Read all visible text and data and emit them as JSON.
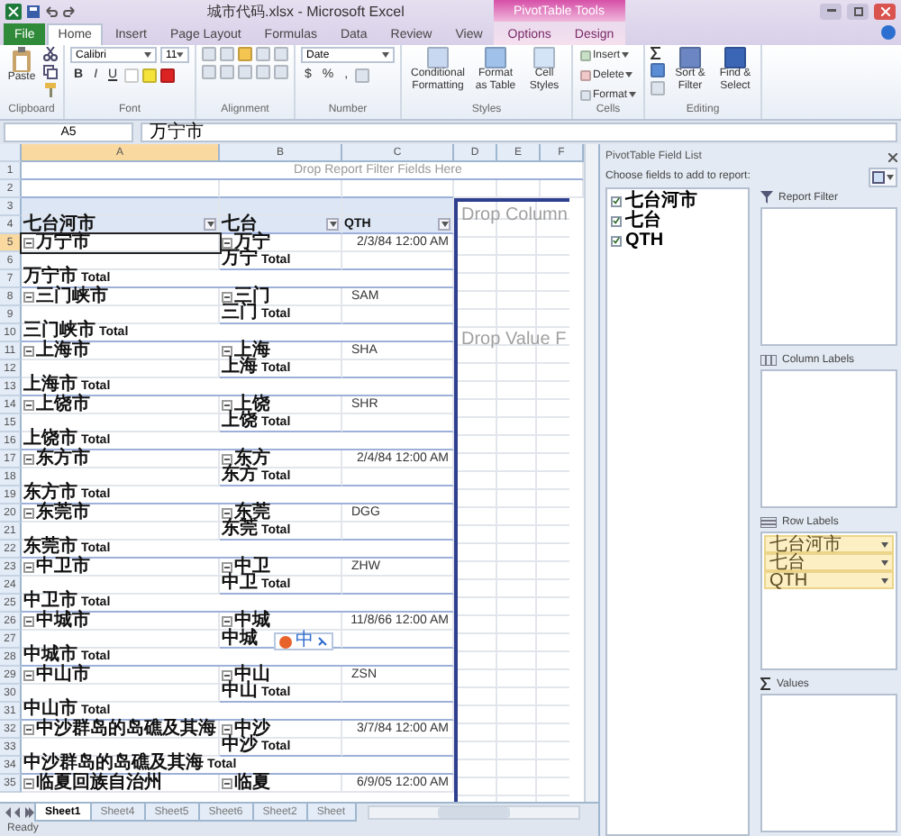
{
  "window": {
    "title": "城市代码.xlsx - Microsoft Excel",
    "context_tab": "PivotTable Tools"
  },
  "ribbon_tabs": [
    {
      "label": "File",
      "kind": "file",
      "selected": false
    },
    {
      "label": "Home",
      "kind": "tab",
      "selected": true
    },
    {
      "label": "Insert",
      "kind": "tab",
      "selected": false
    },
    {
      "label": "Page Layout",
      "kind": "tab",
      "selected": false
    },
    {
      "label": "Formulas",
      "kind": "tab",
      "selected": false
    },
    {
      "label": "Data",
      "kind": "tab",
      "selected": false
    },
    {
      "label": "Review",
      "kind": "tab",
      "selected": false
    },
    {
      "label": "View",
      "kind": "tab",
      "selected": false
    },
    {
      "label": "Options",
      "kind": "context",
      "selected": false
    },
    {
      "label": "Design",
      "kind": "context",
      "selected": false
    }
  ],
  "ribbon": {
    "paste": "Paste",
    "font_name": "Calibri",
    "font_size": "11",
    "font_styles": [
      "B",
      "I",
      "U"
    ],
    "number_format": "Date",
    "number_buttons": [
      "$",
      "%",
      ","
    ],
    "styles_buttons": [
      "Conditional Formatting",
      "Format as Table",
      "Cell Styles"
    ],
    "cells_buttons": [
      "Insert",
      "Delete",
      "Format"
    ],
    "editing_buttons": [
      "Sort & Filter",
      "Find & Select"
    ],
    "groups": [
      "Clipboard",
      "Font",
      "Alignment",
      "Number",
      "Styles",
      "Cells",
      "Editing"
    ]
  },
  "formula_bar": {
    "name_box": "A5",
    "value": "万宁市"
  },
  "columns": [
    "A",
    "B",
    "C",
    "D",
    "E",
    "F"
  ],
  "pivot": {
    "filter_hint": "Drop Report Filter Fields Here",
    "drop_column": "Drop Column",
    "drop_value": "Drop Value F",
    "headers": [
      "七台河市",
      "七台",
      "QTH"
    ]
  },
  "rows": [
    {
      "number": "1",
      "kind": "filter"
    },
    {
      "number": "2",
      "kind": "blank"
    },
    {
      "number": "3",
      "kind": "band"
    },
    {
      "number": "4",
      "kind": "header"
    },
    {
      "number": "5",
      "kind": "date_item",
      "a": "万宁市",
      "b": "万宁",
      "c": "2/3/84 12:00 AM",
      "selected": true
    },
    {
      "number": "6",
      "kind": "subtotal",
      "b": "万宁 Total"
    },
    {
      "number": "7",
      "kind": "total",
      "a": "万宁市 Total"
    },
    {
      "number": "8",
      "kind": "code_item",
      "a": "三门峡市",
      "b": "三门",
      "c": "SAM",
      "selected": false
    },
    {
      "number": "9",
      "kind": "subtotal",
      "b": "三门 Total"
    },
    {
      "number": "10",
      "kind": "total",
      "a": "三门峡市 Total"
    },
    {
      "number": "11",
      "kind": "code_item",
      "a": "上海市",
      "b": "上海",
      "c": "SHA",
      "selected": false
    },
    {
      "number": "12",
      "kind": "subtotal",
      "b": "上海 Total"
    },
    {
      "number": "13",
      "kind": "total",
      "a": "上海市 Total"
    },
    {
      "number": "14",
      "kind": "code_item",
      "a": "上饶市",
      "b": "上饶",
      "c": "SHR",
      "selected": false
    },
    {
      "number": "15",
      "kind": "subtotal",
      "b": "上饶 Total"
    },
    {
      "number": "16",
      "kind": "total",
      "a": "上饶市 Total"
    },
    {
      "number": "17",
      "kind": "date_item",
      "a": "东方市",
      "b": "东方",
      "c": "2/4/84 12:00 AM",
      "selected": false
    },
    {
      "number": "18",
      "kind": "subtotal",
      "b": "东方 Total"
    },
    {
      "number": "19",
      "kind": "total",
      "a": "东方市 Total"
    },
    {
      "number": "20",
      "kind": "code_item",
      "a": "东莞市",
      "b": "东莞",
      "c": "DGG",
      "selected": false
    },
    {
      "number": "21",
      "kind": "subtotal",
      "b": "东莞 Total"
    },
    {
      "number": "22",
      "kind": "total",
      "a": "东莞市 Total"
    },
    {
      "number": "23",
      "kind": "code_item",
      "a": "中卫市",
      "b": "中卫",
      "c": "ZHW",
      "selected": false
    },
    {
      "number": "24",
      "kind": "subtotal",
      "b": "中卫 Total"
    },
    {
      "number": "25",
      "kind": "total",
      "a": "中卫市 Total"
    },
    {
      "number": "26",
      "kind": "date_item",
      "a": "中城市",
      "b": "中城",
      "c": "11/8/66 12:00 AM",
      "selected": false
    },
    {
      "number": "27",
      "kind": "subtotal",
      "b": "中城"
    },
    {
      "number": "28",
      "kind": "total",
      "a": "中城市 Total"
    },
    {
      "number": "29",
      "kind": "code_item",
      "a": "中山市",
      "b": "中山",
      "c": "ZSN",
      "selected": false
    },
    {
      "number": "30",
      "kind": "subtotal",
      "b": "中山 Total"
    },
    {
      "number": "31",
      "kind": "total",
      "a": "中山市 Total"
    },
    {
      "number": "32",
      "kind": "date_item",
      "a": "中沙群岛的岛礁及其海",
      "b": "中沙",
      "c": "3/7/84 12:00 AM",
      "selected": false
    },
    {
      "number": "33",
      "kind": "subtotal",
      "b": "中沙 Total"
    },
    {
      "number": "34",
      "kind": "total",
      "a": "中沙群岛的岛礁及其海 Total"
    },
    {
      "number": "35",
      "kind": "date_item",
      "a": "临夏回族自治州",
      "b": "临夏",
      "c": "6/9/05 12:00 AM",
      "selected": false
    }
  ],
  "ime_bar": {
    "label": "中"
  },
  "sheet_tabs": [
    {
      "label": "Sheet1",
      "selected": true
    },
    {
      "label": "Sheet4",
      "selected": false
    },
    {
      "label": "Sheet5",
      "selected": false
    },
    {
      "label": "Sheet6",
      "selected": false
    },
    {
      "label": "Sheet2",
      "selected": false
    },
    {
      "label": "Sheet",
      "selected": false
    }
  ],
  "status_bar": "Ready",
  "field_list": {
    "title": "PivotTable Field List",
    "prompt": "Choose fields to add to report:",
    "fields": [
      {
        "name": "七台河市",
        "checked": true
      },
      {
        "name": "七台",
        "checked": true
      },
      {
        "name": "QTH",
        "checked": true
      }
    ],
    "areas": [
      {
        "label": "Report Filter",
        "kind": "filter"
      },
      {
        "label": "Column Labels",
        "kind": "column"
      },
      {
        "label": "Row Labels",
        "kind": "row",
        "items": [
          "七台河市",
          "七台",
          "QTH"
        ]
      },
      {
        "label": "Values",
        "kind": "values"
      }
    ]
  }
}
